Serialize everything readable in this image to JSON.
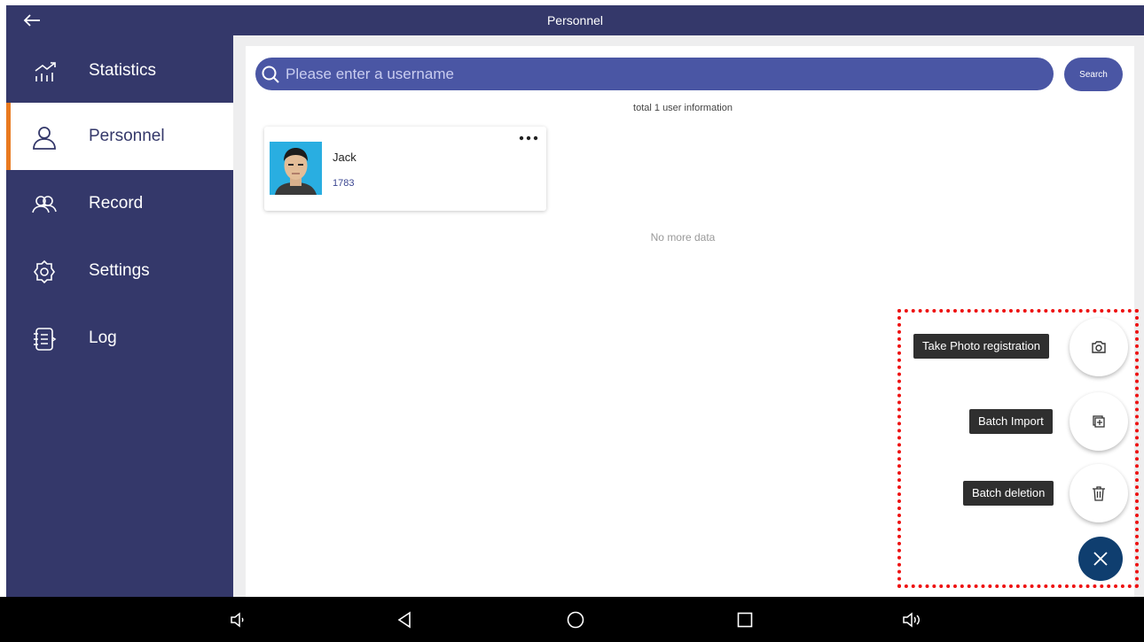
{
  "titlebar": {
    "title": "Personnel",
    "back_icon": "arrow-left-icon"
  },
  "sidebar": {
    "items": [
      {
        "label": "Statistics",
        "icon": "statistics-icon",
        "active": false
      },
      {
        "label": "Personnel",
        "icon": "person-icon",
        "active": true
      },
      {
        "label": "Record",
        "icon": "people-icon",
        "active": false
      },
      {
        "label": "Settings",
        "icon": "gear-icon",
        "active": false
      },
      {
        "label": "Log",
        "icon": "log-icon",
        "active": false
      }
    ]
  },
  "search": {
    "placeholder": "Please enter a username",
    "value": "",
    "button_label": "Search"
  },
  "total_info": "total 1 user information",
  "users": [
    {
      "name": "Jack",
      "id": "1783"
    }
  ],
  "no_more": "No more data",
  "fab": {
    "actions": [
      {
        "label": "Take Photo registration",
        "icon": "camera-icon"
      },
      {
        "label": "Batch Import",
        "icon": "import-icon"
      },
      {
        "label": "Batch deletion",
        "icon": "trash-icon"
      }
    ],
    "close_icon": "close-icon"
  },
  "colors": {
    "sidebar": "#34386a",
    "search": "#4a56a4",
    "accent": "#e97a1f",
    "fab_close": "#0f3e6f",
    "highlight": "#ee1111"
  }
}
